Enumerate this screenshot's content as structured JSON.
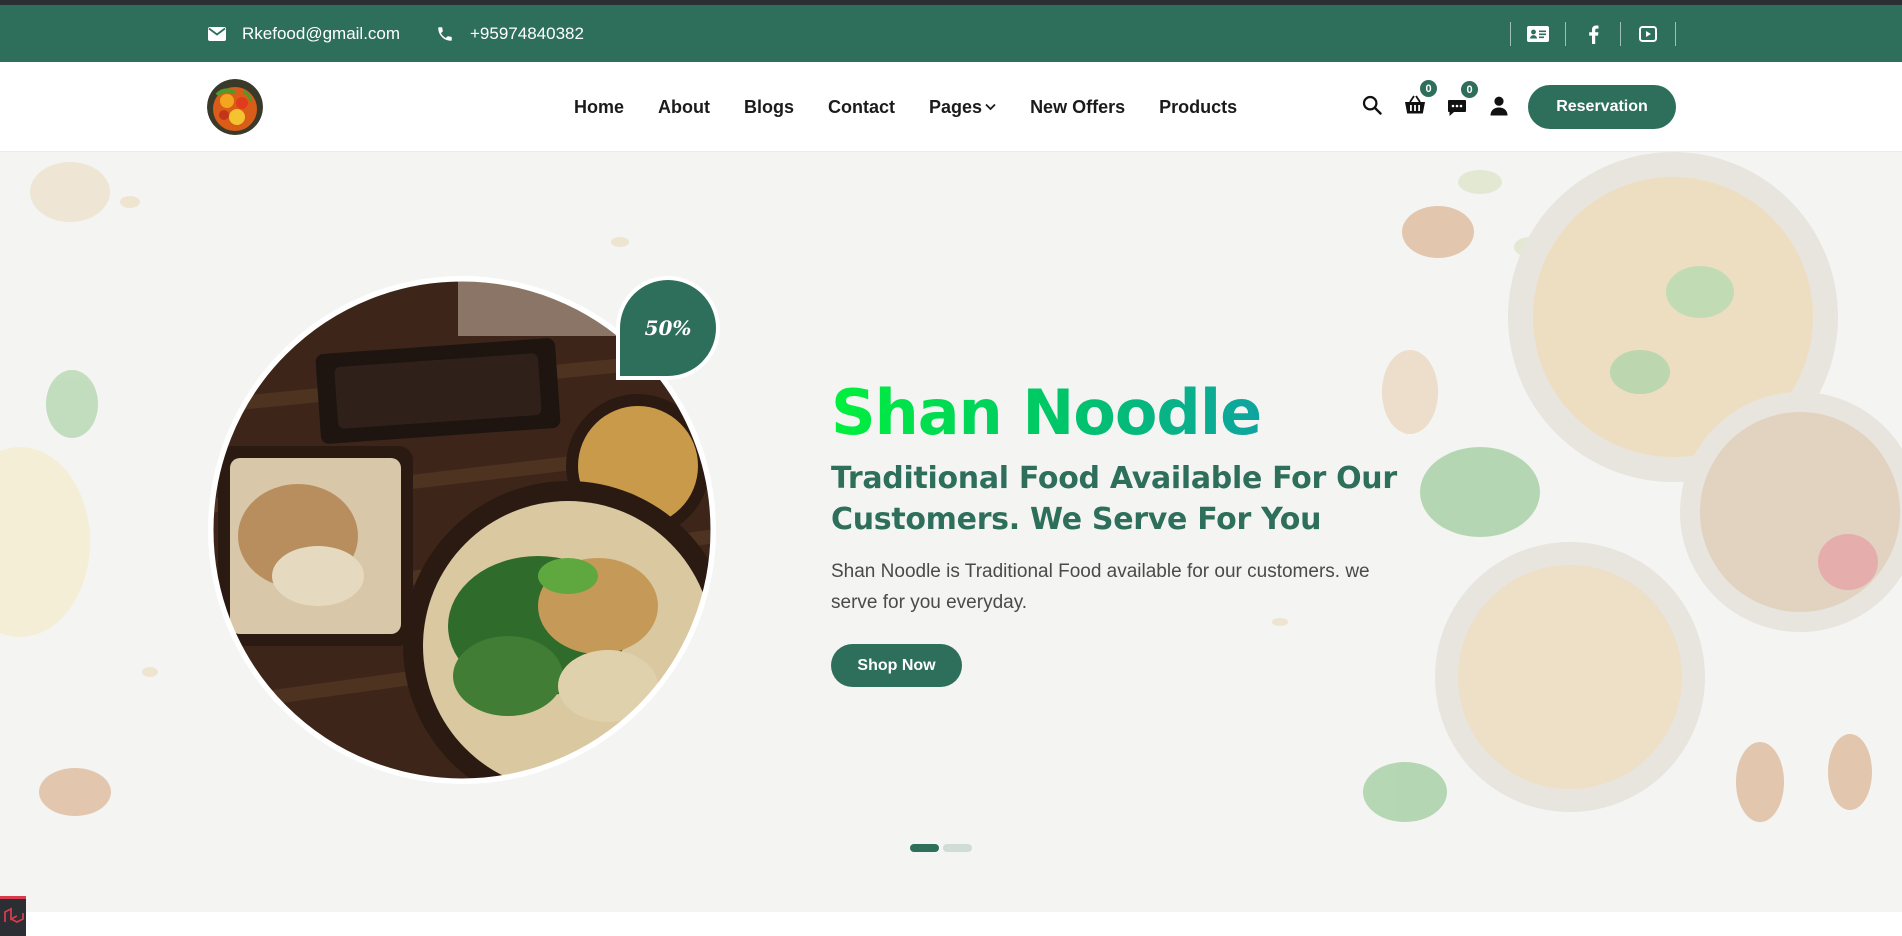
{
  "topbar": {
    "email": "Rkefood@gmail.com",
    "phone": "+95974840382",
    "socials": [
      "contact-card-icon",
      "facebook-icon",
      "youtube-icon"
    ],
    "color": "#2e6f5c"
  },
  "nav": {
    "items": [
      "Home",
      "About",
      "Blogs",
      "Contact",
      "Pages",
      "New Offers",
      "Products"
    ],
    "cart_count": "0",
    "message_count": "0",
    "reservation_label": "Reservation"
  },
  "hero": {
    "discount": "50%",
    "title": "Shan Noodle",
    "subtitle": "Traditional Food Available For Our Customers. We Serve For You",
    "description": "Shan Noodle is Traditional Food available for our customers. we serve for you everyday.",
    "cta_label": "Shop Now",
    "slide_count": 2,
    "active_slide": 1
  }
}
